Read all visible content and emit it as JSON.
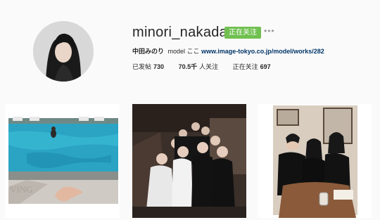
{
  "profile": {
    "username": "minori_nakada",
    "follow_label": "正在关注",
    "more_icon": "more-dots-icon",
    "display_name": "中田みのり",
    "bio_text": "model ここ",
    "bio_link": "www.image-tokyo.co.jp/model/works/282"
  },
  "stats": [
    {
      "label": "已发帖",
      "value": "730"
    },
    {
      "label": "人关注",
      "value": "70.5千"
    },
    {
      "label": "正在关注",
      "value": "697"
    }
  ],
  "posts": [
    {
      "kind": "pool-photo",
      "overlay_text": "VING"
    },
    {
      "kind": "group-photo"
    },
    {
      "kind": "friends-photo"
    }
  ],
  "colors": {
    "follow_green": "#70c050",
    "link": "#003569"
  }
}
